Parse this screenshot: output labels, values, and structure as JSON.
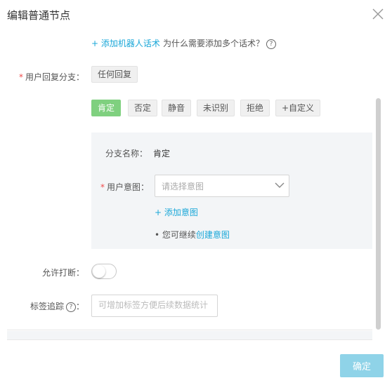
{
  "dialog": {
    "title": "编辑普通节点",
    "ok_label": "确定"
  },
  "form": {
    "add_robot_phrase": "+ 添加机器人话术",
    "why_multiple": "为什么需要添加多个话术？",
    "help_symbol": "?",
    "user_reply_branch_label": "用户回复分支：",
    "required_mark": "*",
    "any_reply_tag": "任何回复",
    "branch_tags": [
      {
        "label": "肯定",
        "active": true
      },
      {
        "label": "否定",
        "active": false
      },
      {
        "label": "静音",
        "active": false
      },
      {
        "label": "未识别",
        "active": false
      },
      {
        "label": "拒绝",
        "active": false
      },
      {
        "label": "+自定义",
        "active": false
      }
    ],
    "panel": {
      "branch_name_label": "分支名称：",
      "branch_name_value": "肯定",
      "user_intent_label": "用户意图：",
      "intent_placeholder": "请选择意图",
      "add_intent": "+ 添加意图",
      "continue_prefix": "• 您可继续",
      "create_intent_link": "创建意图"
    },
    "allow_interrupt_label": "允许打断：",
    "allow_interrupt_on": false,
    "tag_tracking_label": "标签追踪",
    "tag_tracking_colon": "：",
    "tag_tracking_placeholder": "可增加标签方便后续数据统计"
  },
  "colors": {
    "accent_link": "#1aa7d8",
    "active_tag": "#7fd07f",
    "ok_button": "#8fd3e8",
    "required": "#f04b4b"
  }
}
